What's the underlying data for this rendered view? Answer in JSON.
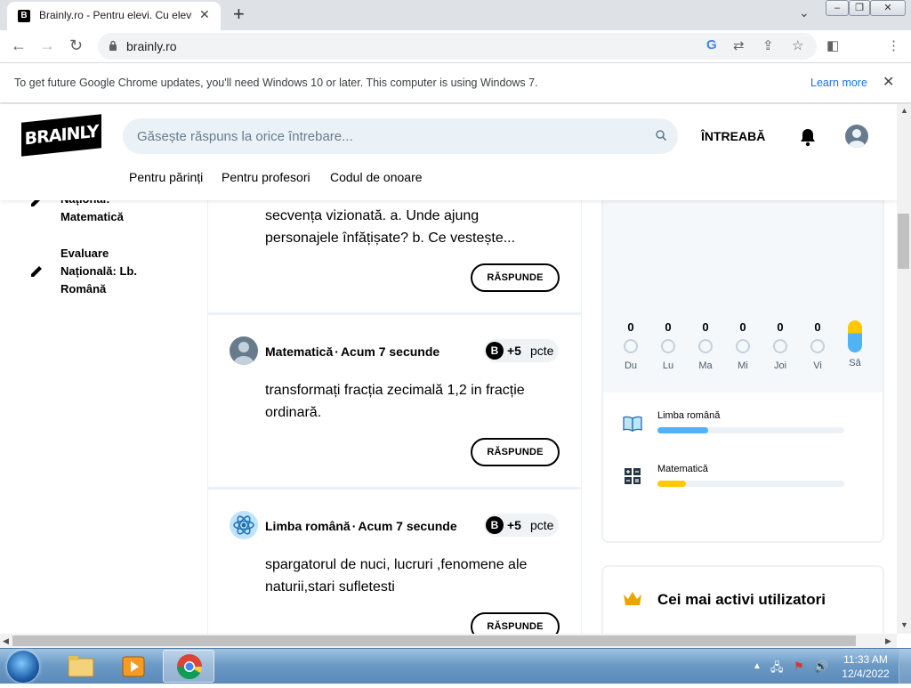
{
  "browser": {
    "tab_title": "Brainly.ro - Pentru elevi. Cu elevi.",
    "tab_favicon": "B",
    "url": "brainly.ro",
    "infobar_message": "To get future Google Chrome updates, you'll need Windows 10 or later. This computer is using Windows 7.",
    "infobar_link": "Learn more"
  },
  "site": {
    "logo": "BRAINLY",
    "search_placeholder": "Găsește răspuns la orice întrebare...",
    "ask_label": "ÎNTREABĂ",
    "nav": [
      "Pentru părinți",
      "Pentru profesori",
      "Codul de onoare"
    ]
  },
  "sidebar": {
    "items": [
      {
        "line1": "Național:",
        "line2": "Matematică",
        "line3": ""
      },
      {
        "line1": "Evaluare",
        "line2": "Națională: Lb.",
        "line3": "Română"
      }
    ]
  },
  "feed": {
    "partial_question": {
      "line1": "secvența vizionată. a. Unde ajung",
      "line2": "personajele înfățișate? b. Ce vestește..."
    },
    "questions": [
      {
        "subject": "Matematică",
        "time": "Acum 7 secunde",
        "points": "+5",
        "points_unit": "pcte",
        "text_line1": "transformați fracția zecimală 1,2 in fracție",
        "text_line2": "ordinară."
      },
      {
        "subject": "Limba română",
        "time": "Acum 7 secunde",
        "points": "+5",
        "points_unit": "pcte",
        "text_line1": "spargatorul de nuci, lucruri ,fenomene ale",
        "text_line2": "naturii,stari sufletesti"
      }
    ],
    "reply_label": "RĂSPUNDE",
    "separator": "·"
  },
  "streak": {
    "days": [
      {
        "label": "Du",
        "count": "0"
      },
      {
        "label": "Lu",
        "count": "0"
      },
      {
        "label": "Ma",
        "count": "0"
      },
      {
        "label": "Mi",
        "count": "0"
      },
      {
        "label": "Joi",
        "count": "0"
      },
      {
        "label": "Vi",
        "count": "0"
      },
      {
        "label": "Sâ",
        "count": ""
      }
    ]
  },
  "progress": [
    {
      "subject": "Limba română",
      "fraction": 0.27,
      "color": "#4fb3f6"
    },
    {
      "subject": "Matematică",
      "fraction": 0.15,
      "color": "#ffc800"
    }
  ],
  "leaderboard": {
    "title": "Cei mai activi utilizatori"
  },
  "taskbar": {
    "time": "11:33 AM",
    "date": "12/4/2022"
  }
}
